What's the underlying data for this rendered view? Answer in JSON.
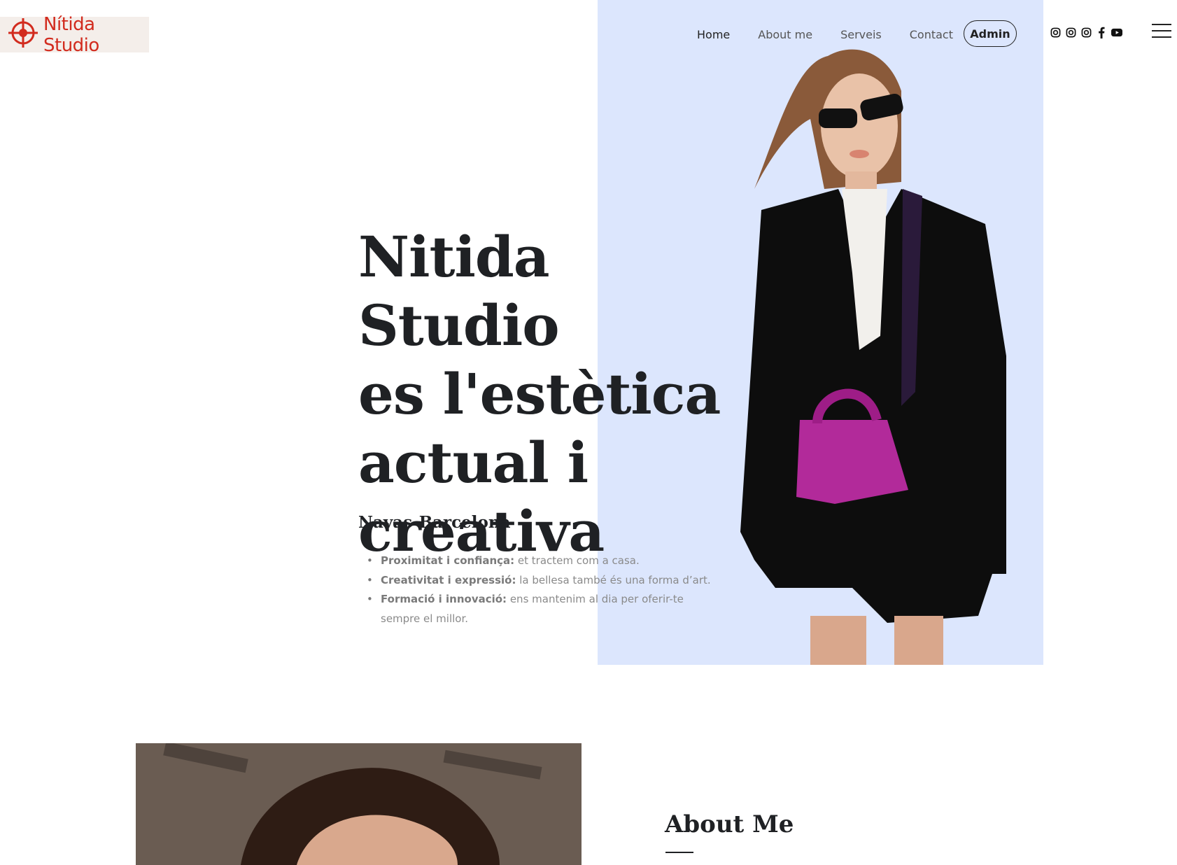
{
  "brand": {
    "name": "Nítida Studio",
    "color": "#d22b1e",
    "icon": "crosshair-target-icon"
  },
  "nav": {
    "items": [
      {
        "label": "Home",
        "active": true
      },
      {
        "label": "About me",
        "active": false
      },
      {
        "label": "Serveis",
        "active": false
      },
      {
        "label": "Contact",
        "active": false
      }
    ],
    "admin_label": "Admin",
    "socials": [
      "instagram-icon",
      "instagram-icon",
      "instagram-icon",
      "facebook-icon",
      "youtube-icon"
    ],
    "menu_icon": "hamburger-menu-icon"
  },
  "hero": {
    "title_lines": [
      "Nitida Studio",
      "es l'estètica",
      "actual i",
      "creativa"
    ],
    "subtitle": "Navas-Barcelona",
    "bullets": [
      {
        "bold": "Proximitat i confiança:",
        "text": " et tractem com a casa."
      },
      {
        "bold": "Creativitat i expressió:",
        "text": " la bellesa també és una forma d’art."
      },
      {
        "bold": "Formació i innovació:",
        "text": " ens mantenim al dia per oferir-te sempre el millor."
      }
    ],
    "panel_color": "#dce6fd"
  },
  "about": {
    "title": "About Me"
  }
}
